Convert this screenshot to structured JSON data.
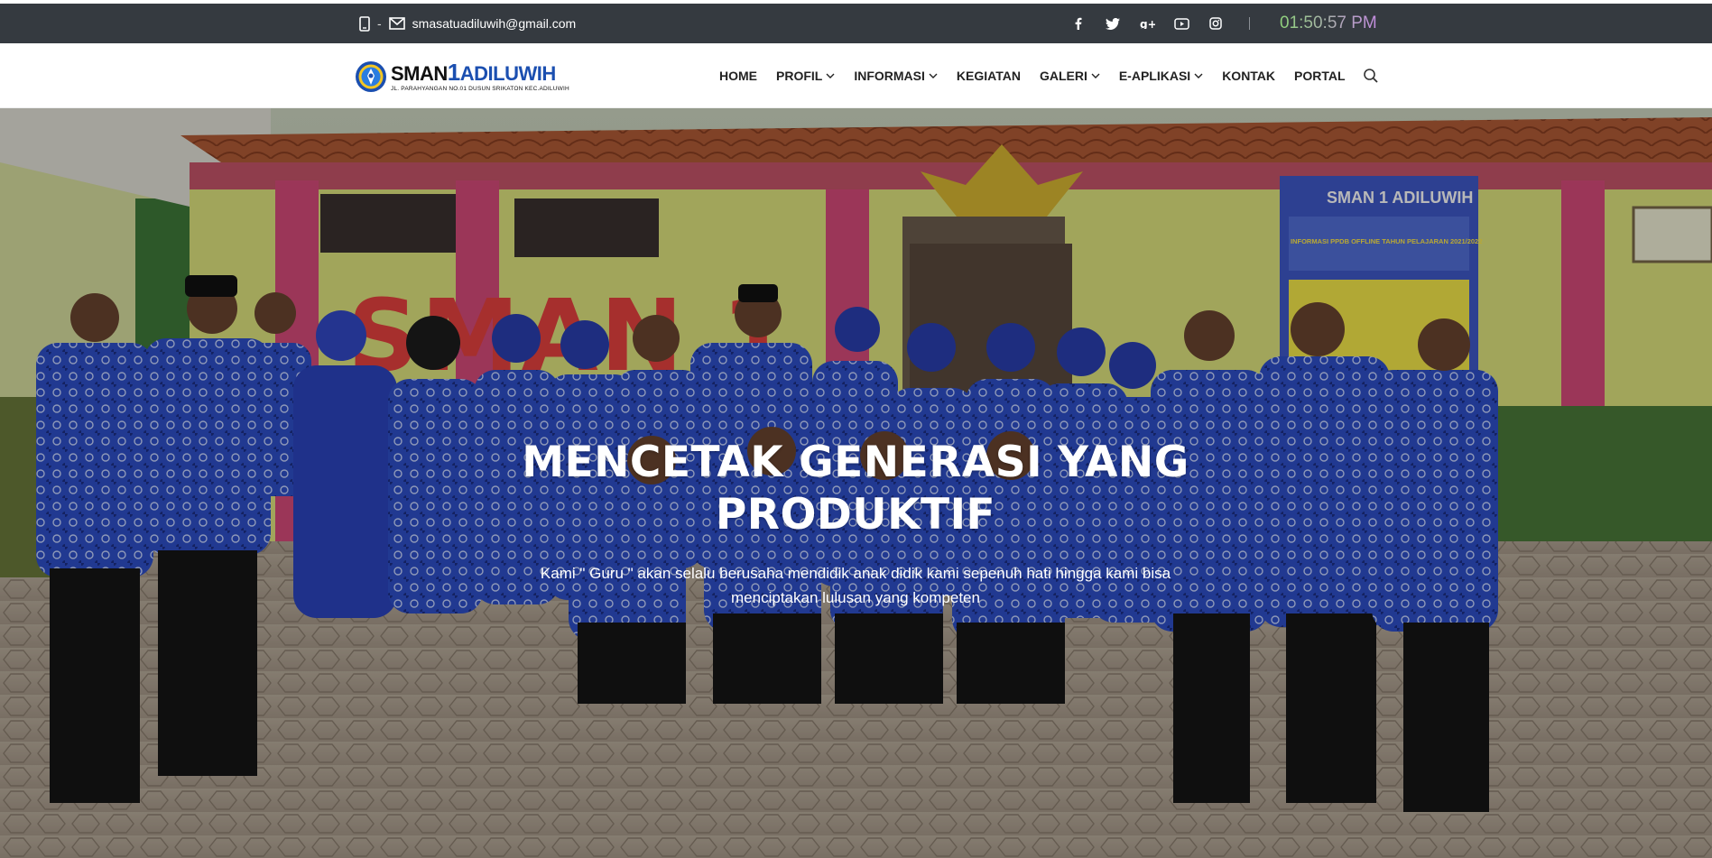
{
  "topbar": {
    "separator": "-",
    "email": "smasatuadiluwih@gmail.com",
    "clock": "01:50:57 PM",
    "social": [
      "facebook-icon",
      "twitter-icon",
      "google-plus-icon",
      "youtube-icon",
      "instagram-icon"
    ]
  },
  "logo": {
    "name_prefix": "SMAN",
    "name_number": "1",
    "name_suffix": "ADILUWIH",
    "address": "JL. PARAHYANGAN NO.01 DUSUN SRIKATON KEC.ADILUWIH"
  },
  "nav": {
    "home": "HOME",
    "profil": "PROFIL",
    "informasi": "INFORMASI",
    "kegiatan": "KEGIATAN",
    "galeri": "GALERI",
    "e_aplikasi": "E-APLIKASI",
    "kontak": "KONTAK",
    "portal": "PORTAL"
  },
  "hero": {
    "title": "MENCETAK GENERASI YANG PRODUKTIF",
    "subtitle": "Kami \" Guru \" akan selalu berusaha mendidik anak didik kami sepenuh hati hingga kami bisa menciptakan lulusan yang kompeten",
    "wall_sign": "SMAN 1",
    "banner_title": "SMAN 1 ADILUWIH",
    "banner_subtitle": "INFORMASI PPDB OFFLINE TAHUN PELAJARAN 2021/2022"
  },
  "colors": {
    "topbar_bg": "#353a40",
    "clock_start": "#8fd37a",
    "clock_end": "#c48ce0",
    "brand_blue": "#1b4fb0"
  }
}
